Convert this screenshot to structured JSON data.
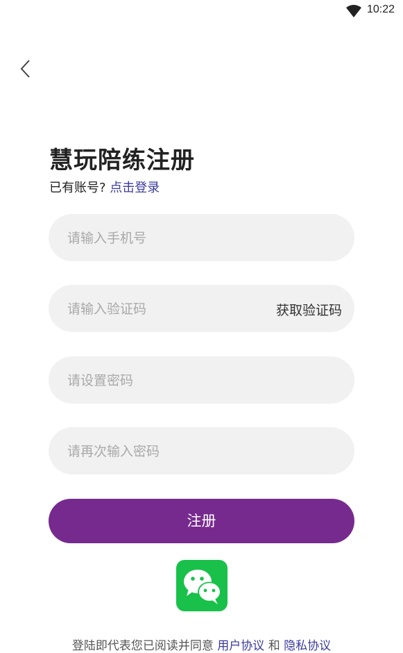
{
  "status_bar": {
    "time": "10:22",
    "icon": "wifi-icon"
  },
  "nav": {
    "back_icon": "back-chevron-icon"
  },
  "title": "慧玩陪练注册",
  "login_prompt": {
    "text": "已有账号?",
    "link": "点击登录"
  },
  "fields": {
    "phone": {
      "placeholder": "请输入手机号",
      "value": ""
    },
    "code": {
      "placeholder": "请输入验证码",
      "value": "",
      "action": "获取验证码"
    },
    "password": {
      "placeholder": "请设置密码",
      "value": ""
    },
    "password_confirm": {
      "placeholder": "请再次输入密码",
      "value": ""
    }
  },
  "register_button": "注册",
  "wechat": {
    "icon": "wechat-icon"
  },
  "agreement": {
    "prefix": "登陆即代表您已阅读并同意",
    "user_agreement": "用户协议",
    "and": "和",
    "privacy_policy": "隐私协议"
  },
  "colors": {
    "accent": "#762a8e",
    "link": "#3a3aa0",
    "field_bg": "#f1f1f1",
    "wechat_green": "#19c14a"
  }
}
